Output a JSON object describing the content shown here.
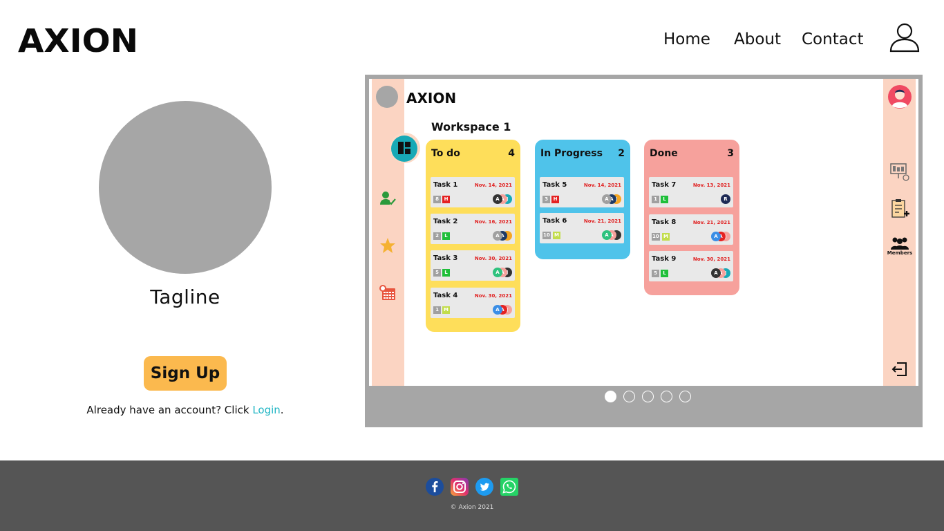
{
  "header": {
    "logo": "AXION",
    "nav": [
      {
        "label": "Home"
      },
      {
        "label": "About"
      },
      {
        "label": "Contact"
      }
    ],
    "user_icon": "user-outline-icon"
  },
  "hero": {
    "tagline": "Tagline",
    "signup_label": "Sign Up",
    "login_prefix": "Already have an account? Click ",
    "login_link": "Login",
    "login_suffix": "."
  },
  "carousel": {
    "slide_count": 5,
    "active_index": 0,
    "preview": {
      "app_logo": "AXION",
      "workspace_title": "Workspace 1",
      "members_label": "Members",
      "columns": [
        {
          "title": "To do",
          "count": "4",
          "color": "#fede5a",
          "tasks": [
            {
              "title": "Task 1",
              "date": "Nov. 14, 2021",
              "num": "8",
              "priority": "H",
              "avatars": [
                "A",
                "A",
                "J"
              ]
            },
            {
              "title": "Task 2",
              "date": "Nov. 16, 2021",
              "num": "2",
              "priority": "L",
              "avatars": [
                "A",
                "A",
                ""
              ]
            },
            {
              "title": "Task 3",
              "date": "Nov. 30, 2021",
              "num": "5",
              "priority": "L",
              "avatars": [
                "A",
                "A",
                "J"
              ]
            },
            {
              "title": "Task 4",
              "date": "Nov. 30, 2021",
              "num": "1",
              "priority": "M",
              "avatars": [
                "A",
                "A",
                "J"
              ]
            }
          ]
        },
        {
          "title": "In Progress",
          "count": "2",
          "color": "#4fc3ea",
          "tasks": [
            {
              "title": "Task 5",
              "date": "Nov. 14, 2021",
              "num": "3",
              "priority": "H",
              "avatars": [
                "A",
                "A",
                "J"
              ]
            },
            {
              "title": "Task 6",
              "date": "Nov. 21, 2021",
              "num": "10",
              "priority": "M",
              "avatars": [
                "A",
                "A",
                ""
              ]
            }
          ]
        },
        {
          "title": "Done",
          "count": "3",
          "color": "#f6a19c",
          "tasks": [
            {
              "title": "Task 7",
              "date": "Nov. 13, 2021",
              "num": "1",
              "priority": "L",
              "avatars": [
                "R"
              ]
            },
            {
              "title": "Task 8",
              "date": "Nov. 21, 2021",
              "num": "10",
              "priority": "M",
              "avatars": [
                "A",
                "A",
                "J"
              ]
            },
            {
              "title": "Task 9",
              "date": "Nov. 30, 2021",
              "num": "5",
              "priority": "L",
              "avatars": [
                "A",
                "A",
                "J"
              ]
            }
          ]
        }
      ]
    }
  },
  "footer": {
    "social": [
      {
        "name": "facebook-icon"
      },
      {
        "name": "instagram-icon"
      },
      {
        "name": "twitter-icon"
      },
      {
        "name": "whatsapp-icon"
      }
    ],
    "copyright": "© Axion 2021"
  },
  "colors": {
    "accent_button": "#fbb94e",
    "link": "#1fb5c4",
    "footer_bg": "#555555",
    "placeholder_gray": "#a6a6a6",
    "sidebar_peach": "#fbd4c2"
  }
}
